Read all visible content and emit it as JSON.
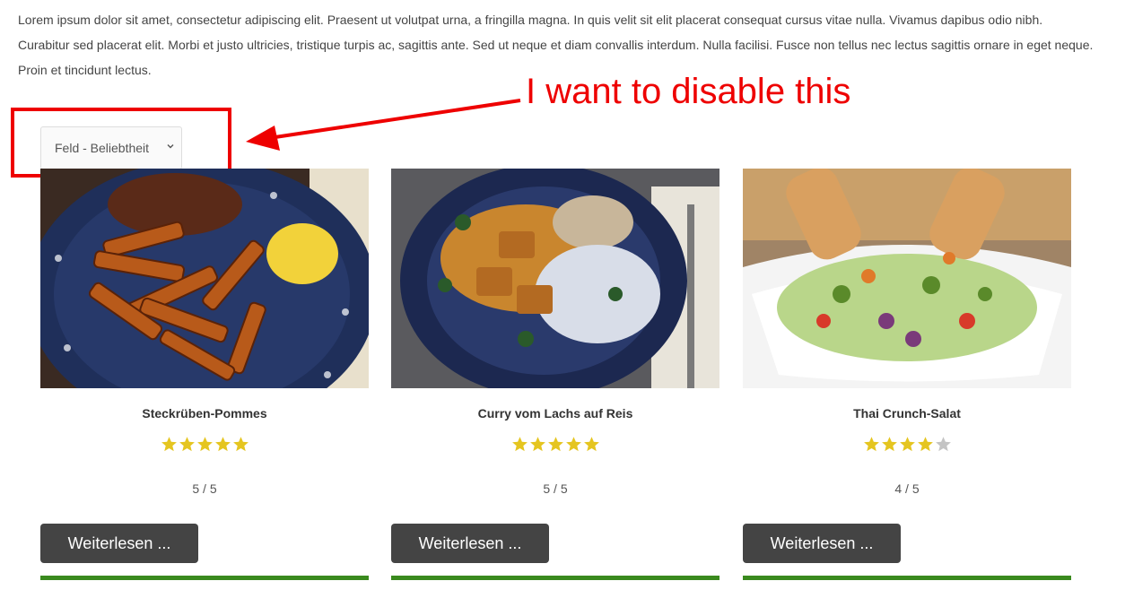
{
  "intro_text": "Lorem ipsum dolor sit amet, consectetur adipiscing elit. Praesent ut volutpat urna, a fringilla magna. In quis velit sit elit placerat consequat cursus vitae nulla. Vivamus dapibus odio nibh. Curabitur sed placerat elit. Morbi et justo ultricies, tristique turpis ac, sagittis ante. Sed ut neque et diam convallis interdum. Nulla facilisi. Fusce non tellus nec lectus sagittis ornare in eget neque. Proin et tincidunt lectus.",
  "annotation": {
    "text": "I want to disable this",
    "color": "#ee0000"
  },
  "sort": {
    "selected": "Feld - Beliebtheit"
  },
  "colors": {
    "star_filled": "#e5c520",
    "star_empty": "#c4c4c4",
    "button_bg": "#444444",
    "bar": "#3a8a1e"
  },
  "recipes": [
    {
      "title": "Steckrüben-Pommes",
      "rating": 5,
      "rating_max": 5,
      "rating_text": "5 / 5",
      "button_label": "Weiterlesen ..."
    },
    {
      "title": "Curry vom Lachs auf Reis",
      "rating": 5,
      "rating_max": 5,
      "rating_text": "5 / 5",
      "button_label": "Weiterlesen ..."
    },
    {
      "title": "Thai Crunch-Salat",
      "rating": 4,
      "rating_max": 5,
      "rating_text": "4 / 5",
      "button_label": "Weiterlesen ..."
    }
  ]
}
